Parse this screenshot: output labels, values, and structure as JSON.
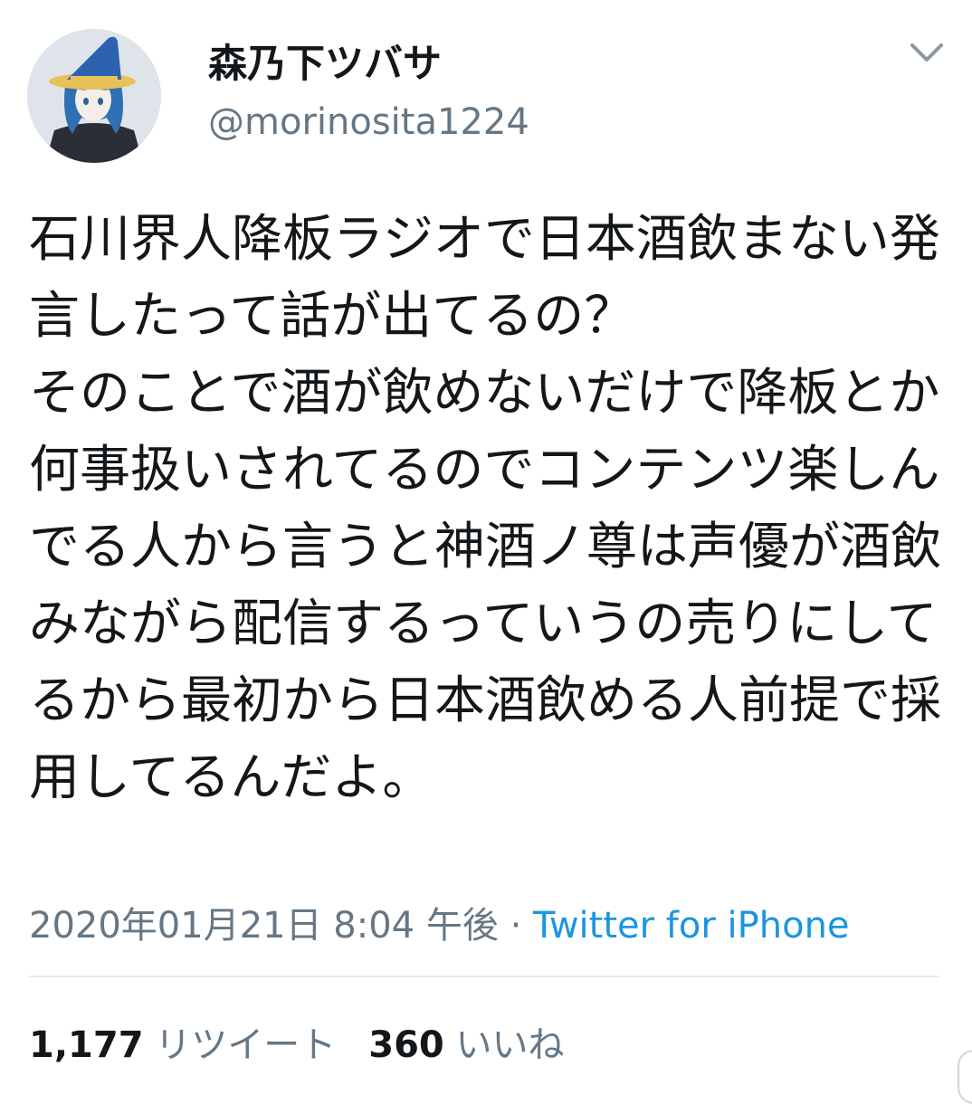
{
  "author": {
    "display_name": "森乃下ツバサ",
    "handle": "@morinosita1224"
  },
  "tweet": {
    "text": "石川界人降板ラジオで日本酒飲まない発言したって話が出てるの？\nそのことで酒が飲めないだけで降板とか何事扱いされてるのでコンテンツ楽しんでる人から言うと神酒ノ尊は声優が酒飲みながら配信するっていうの売りにしてるから最初から日本酒飲める人前提で採用してるんだよ。",
    "timestamp": "2020年01月21日 8:04 午後",
    "separator": " · ",
    "source": "Twitter for iPhone"
  },
  "stats": {
    "retweets_count": "1,177",
    "retweets_label": "リツイート",
    "likes_count": "360",
    "likes_label": "いいね"
  },
  "icons": {
    "avatar": "witch-hat-avatar",
    "menu": "chevron-down-icon"
  },
  "colors": {
    "text": "#14171a",
    "secondary": "#657786",
    "link": "#1b95e0",
    "divider": "#e6ecf0"
  }
}
